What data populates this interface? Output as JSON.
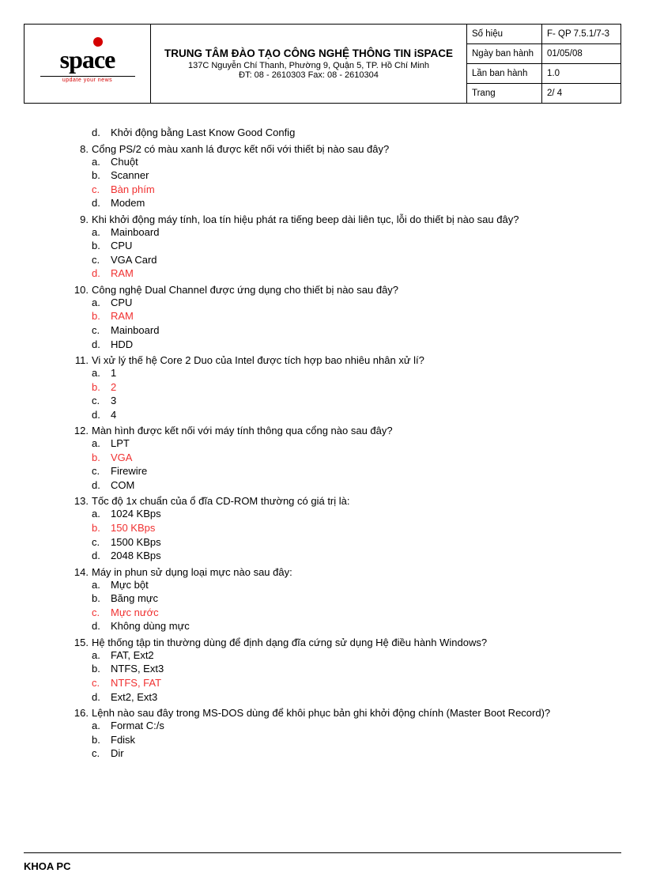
{
  "header": {
    "logo_text": "space",
    "logo_sub": "update your news",
    "title": "TRUNG  TÂM ĐÀO TẠO CÔNG NGHỆ THÔNG TIN iSPACE",
    "address": "137C Nguyễn Chí Thanh, Phường 9, Quận 5, TP. Hồ Chí Minh",
    "phone": "ĐT: 08 - 2610303     Fax: 08 - 2610304",
    "meta": [
      {
        "label": "Số hiệu",
        "value": "F- QP 7.5.1/7-3"
      },
      {
        "label": "Ngày ban hành",
        "value": "01/05/08"
      },
      {
        "label": "Lần ban hành",
        "value": "1.0"
      },
      {
        "label": "Trang",
        "value": "2/ 4"
      }
    ]
  },
  "orphan_option": {
    "letter": "d.",
    "text": "Khởi động bằng Last Know Good Config",
    "correct": false
  },
  "questions": [
    {
      "num": "8.",
      "text": "Cổng PS/2 có màu xanh lá được kết nối với thiết bị nào sau đây?",
      "options": [
        {
          "letter": "a.",
          "text": "Chuột",
          "correct": false
        },
        {
          "letter": "b.",
          "text": "Scanner",
          "correct": false
        },
        {
          "letter": "c.",
          "text": "Bàn phím",
          "correct": true
        },
        {
          "letter": "d.",
          "text": "Modem",
          "correct": false
        }
      ]
    },
    {
      "num": "9.",
      "text": "Khi khởi động máy tính, loa tín hiệu phát ra tiếng beep dài liên tục, lỗi do thiết bị nào sau đây?",
      "options": [
        {
          "letter": "a.",
          "text": "Mainboard",
          "correct": false
        },
        {
          "letter": "b.",
          "text": "CPU",
          "correct": false
        },
        {
          "letter": "c.",
          "text": "VGA Card",
          "correct": false
        },
        {
          "letter": "d.",
          "text": "RAM",
          "correct": true
        }
      ]
    },
    {
      "num": "10.",
      "text": "Công nghệ Dual Channel được ứng dụng cho thiết bị nào sau đây?",
      "options": [
        {
          "letter": "a.",
          "text": "CPU",
          "correct": false
        },
        {
          "letter": "b.",
          "text": "RAM",
          "correct": true
        },
        {
          "letter": "c.",
          "text": "Mainboard",
          "correct": false
        },
        {
          "letter": "d.",
          "text": "HDD",
          "correct": false
        }
      ]
    },
    {
      "num": "11.",
      "text": "Vi xử lý thế hệ Core 2 Duo của Intel được tích hợp bao nhiêu nhân xử lí?",
      "options": [
        {
          "letter": "a.",
          "text": "1",
          "correct": false
        },
        {
          "letter": "b.",
          "text": "2",
          "correct": true
        },
        {
          "letter": "c.",
          "text": "3",
          "correct": false
        },
        {
          "letter": "d.",
          "text": "4",
          "correct": false
        }
      ]
    },
    {
      "num": "12.",
      "text": "Màn hình được kết nối với máy tính thông qua cổng nào sau đây?",
      "options": [
        {
          "letter": "a.",
          "text": "LPT",
          "correct": false
        },
        {
          "letter": "b.",
          "text": "VGA",
          "correct": true
        },
        {
          "letter": "c.",
          "text": "Firewire",
          "correct": false
        },
        {
          "letter": "d.",
          "text": "COM",
          "correct": false
        }
      ]
    },
    {
      "num": "13.",
      "text": "Tốc độ 1x chuẩn của ổ đĩa CD-ROM thường có giá trị là:",
      "options": [
        {
          "letter": "a.",
          "text": "1024 KBps",
          "correct": false
        },
        {
          "letter": "b.",
          "text": "150 KBps",
          "correct": true
        },
        {
          "letter": "c.",
          "text": "1500 KBps",
          "correct": false
        },
        {
          "letter": "d.",
          "text": "2048 KBps",
          "correct": false
        }
      ]
    },
    {
      "num": "14.",
      "text": "Máy in phun sử dụng loại mực nào sau đây:",
      "options": [
        {
          "letter": "a.",
          "text": "Mực bột",
          "correct": false
        },
        {
          "letter": "b.",
          "text": "Băng mực",
          "correct": false
        },
        {
          "letter": "c.",
          "text": "Mực nước",
          "correct": true
        },
        {
          "letter": "d.",
          "text": "Không dùng mực",
          "correct": false
        }
      ]
    },
    {
      "num": "15.",
      "text": "Hệ thống tập tin thường dùng để định dạng đĩa cứng sử dụng Hệ điều hành Windows?",
      "options": [
        {
          "letter": "a.",
          "text": "FAT, Ext2",
          "correct": false
        },
        {
          "letter": "b.",
          "text": "NTFS, Ext3",
          "correct": false
        },
        {
          "letter": "c.",
          "text": "NTFS, FAT",
          "correct": true
        },
        {
          "letter": "d.",
          "text": "Ext2, Ext3",
          "correct": false
        }
      ]
    },
    {
      "num": "16.",
      "text": "Lệnh nào sau đây trong MS-DOS dùng để khôi phục bản ghi khởi động chính (Master Boot Record)?",
      "options": [
        {
          "letter": "a.",
          "text": "Format C:/s",
          "correct": false
        },
        {
          "letter": "b.",
          "text": "Fdisk",
          "correct": false
        },
        {
          "letter": "c.",
          "text": "Dir",
          "correct": false
        }
      ]
    }
  ],
  "footer": "KHOA PC"
}
